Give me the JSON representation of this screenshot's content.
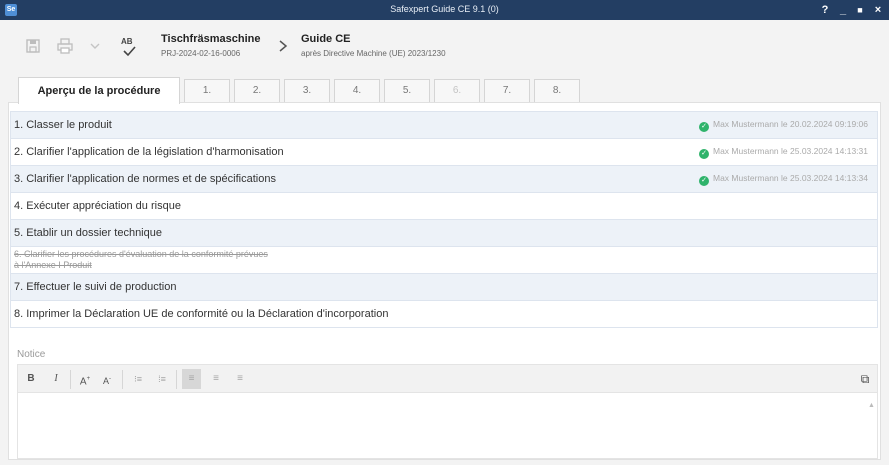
{
  "window": {
    "app_icon": "Se",
    "title": "Safexpert Guide CE 9.1 (0)",
    "help": "?",
    "minimize": "_",
    "maximize": "■",
    "close": "×"
  },
  "header": {
    "project_name": "Tischfräsmaschine",
    "project_id": "PRJ-2024-02-16-0006",
    "guide_title": "Guide CE",
    "guide_subtitle": "après Directive Machine (UE) 2023/1230",
    "icons": [
      "save-icon",
      "print-icon",
      "chevron-down-icon",
      "spellcheck-icon"
    ],
    "spellcheck_text": "AB"
  },
  "tabs": [
    {
      "label": "Aperçu de la procédure",
      "active": true
    },
    {
      "label": "1."
    },
    {
      "label": "2."
    },
    {
      "label": "3."
    },
    {
      "label": "4."
    },
    {
      "label": "5."
    },
    {
      "label": "6.",
      "disabled": true
    },
    {
      "label": "7."
    },
    {
      "label": "8."
    }
  ],
  "steps": [
    {
      "label": "1. Classer le produit",
      "status": "Max Mustermann le 20.02.2024 09:19:06",
      "done": true
    },
    {
      "label": "2. Clarifier l'application de la législation d'harmonisation",
      "status": "Max Mustermann le 25.03.2024 14:13:31",
      "done": true
    },
    {
      "label": "3. Clarifier l'application de normes et de spécifications",
      "status": "Max Mustermann le 25.03.2024 14:13:34",
      "done": true
    },
    {
      "label": "4. Exécuter appréciation du risque"
    },
    {
      "label": "5. Etablir un dossier technique"
    },
    {
      "label": "6. Clarifier les procédures d'évaluation de la conformité prévues à l'Annexe I Produit",
      "strike": true
    },
    {
      "label": "7. Effectuer le suivi de production"
    },
    {
      "label": "8. Imprimer la Déclaration UE de conformité ou la Déclaration d'incorporation"
    }
  ],
  "notice": {
    "label": "Notice",
    "toolbar": {
      "bold": "B",
      "italic": "I",
      "font_grow": "A",
      "font_shrink": "A",
      "bullet_list": "⁝≡",
      "numbered_list": "⁞≡",
      "align_left": "≡",
      "align_center": "≡",
      "align_right": "≡",
      "external": "⧉"
    },
    "content": ""
  },
  "colors": {
    "titlebar": "#233e63",
    "row_shade": "#edf2f8",
    "check_green": "#2fb36b"
  }
}
